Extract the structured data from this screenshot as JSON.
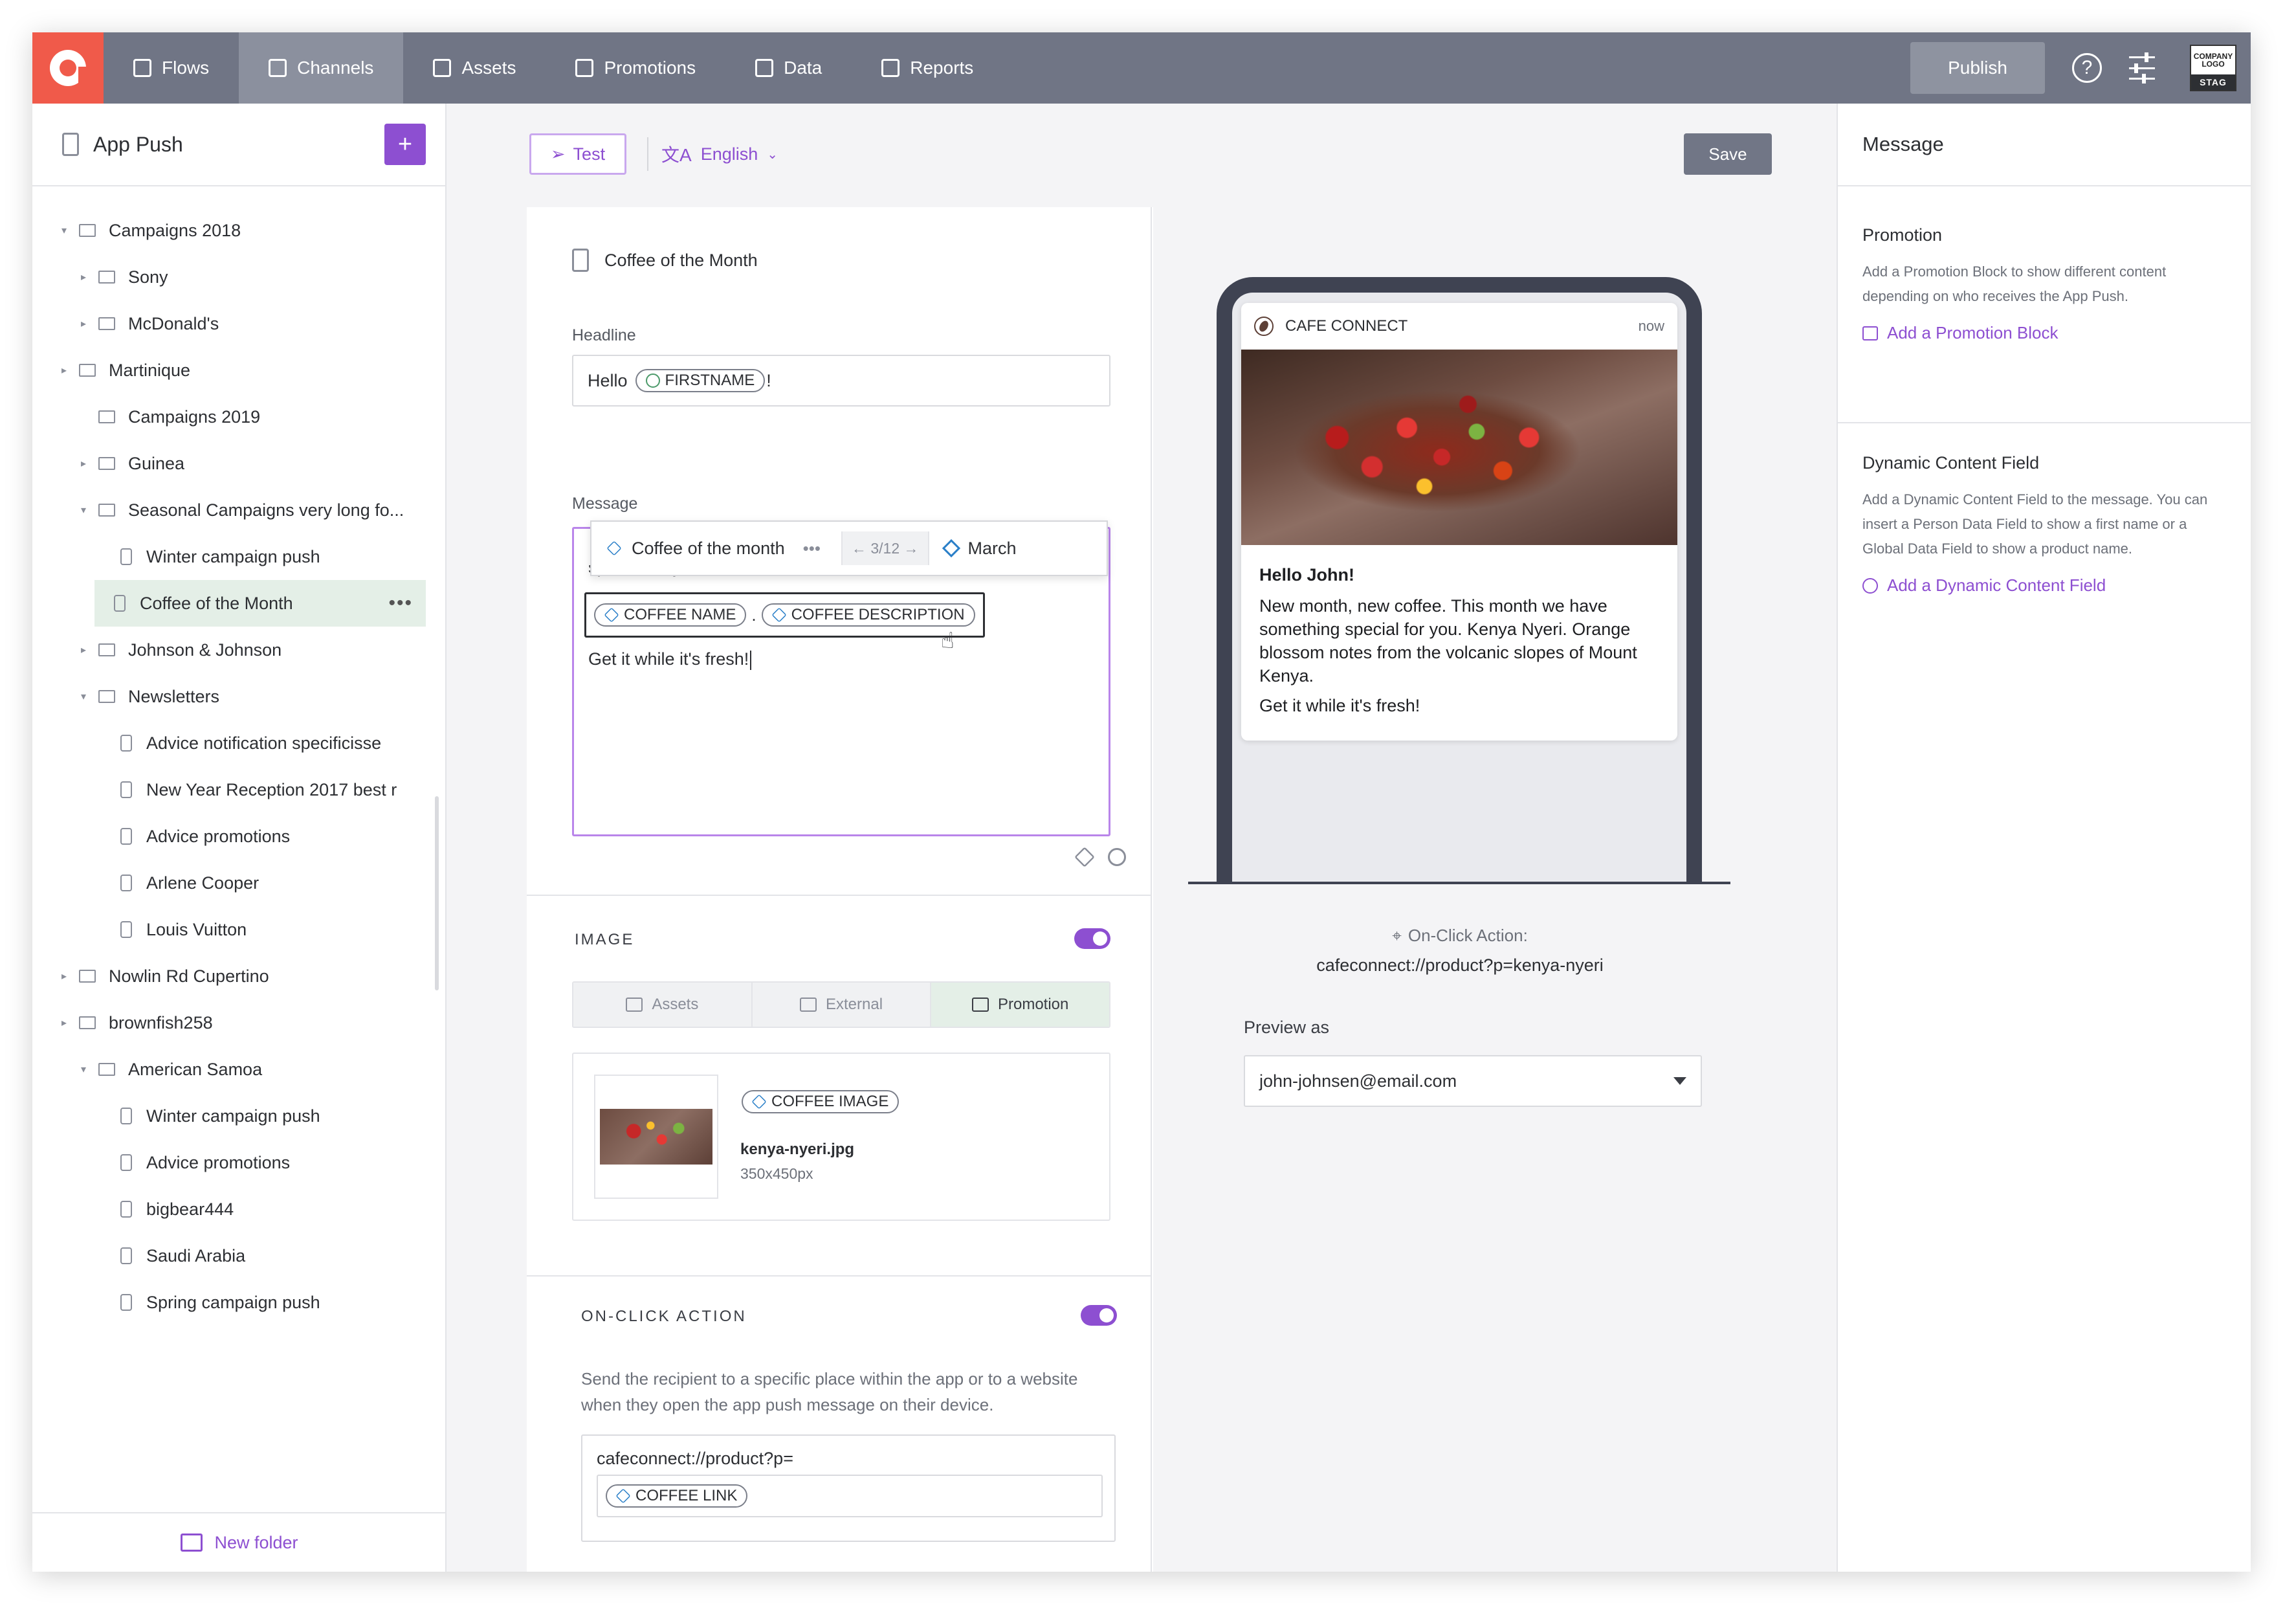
{
  "nav": {
    "items": [
      {
        "label": "Flows",
        "icon": "flow-icon"
      },
      {
        "label": "Channels",
        "icon": "channels-icon",
        "active": true
      },
      {
        "label": "Assets",
        "icon": "assets-icon"
      },
      {
        "label": "Promotions",
        "icon": "promotions-icon"
      },
      {
        "label": "Data",
        "icon": "database-icon"
      },
      {
        "label": "Reports",
        "icon": "reports-icon"
      }
    ],
    "publish_label": "Publish",
    "help_glyph": "?",
    "company_logo_text": "COMPANY LOGO",
    "environment": "STAG"
  },
  "sidebar": {
    "title": "App Push",
    "add_label": "+",
    "tree": [
      {
        "label": "Campaigns 2018",
        "type": "folder",
        "depth": 0,
        "caret": "▾"
      },
      {
        "label": "Sony",
        "type": "folder",
        "depth": 1,
        "caret": "▸"
      },
      {
        "label": "McDonald's",
        "type": "folder",
        "depth": 1,
        "caret": "▸"
      },
      {
        "label": "Martinique",
        "type": "folder",
        "depth": 0,
        "caret": "▸"
      },
      {
        "label": "Campaigns 2019",
        "type": "folder",
        "depth": 1,
        "caret": ""
      },
      {
        "label": "Guinea",
        "type": "folder",
        "depth": 1,
        "caret": "▸"
      },
      {
        "label": "Seasonal Campaigns very long fo...",
        "type": "folder",
        "depth": 1,
        "caret": "▾"
      },
      {
        "label": "Winter campaign push",
        "type": "message",
        "depth": 2
      },
      {
        "label": "Coffee of the Month",
        "type": "message",
        "depth": 2,
        "selected": true
      },
      {
        "label": "Johnson & Johnson",
        "type": "folder",
        "depth": 1,
        "caret": "▸"
      },
      {
        "label": "Newsletters",
        "type": "folder",
        "depth": 1,
        "caret": "▾"
      },
      {
        "label": "Advice notification specificisse",
        "type": "message",
        "depth": 2
      },
      {
        "label": "New Year Reception 2017 best r",
        "type": "message",
        "depth": 2
      },
      {
        "label": "Advice promotions",
        "type": "message",
        "depth": 2
      },
      {
        "label": "Arlene Cooper",
        "type": "message",
        "depth": 2
      },
      {
        "label": "Louis Vuitton",
        "type": "message",
        "depth": 2
      },
      {
        "label": "Nowlin Rd Cupertino",
        "type": "folder",
        "depth": 0,
        "caret": "▸"
      },
      {
        "label": "brownfish258",
        "type": "folder",
        "depth": 0,
        "caret": "▸"
      },
      {
        "label": "American Samoa",
        "type": "folder",
        "depth": 1,
        "caret": "▾"
      },
      {
        "label": "Winter campaign push",
        "type": "message",
        "depth": 2
      },
      {
        "label": "Advice promotions",
        "type": "message",
        "depth": 2
      },
      {
        "label": "bigbear444",
        "type": "message",
        "depth": 2
      },
      {
        "label": "Saudi Arabia",
        "type": "message",
        "depth": 2
      },
      {
        "label": "Spring campaign push",
        "type": "message",
        "depth": 2
      }
    ],
    "more_glyph": "•••",
    "new_folder_label": "New folder"
  },
  "toolbar": {
    "test_label": "Test",
    "language_label": "English",
    "language_glyph": "文A",
    "save_label": "Save"
  },
  "editor": {
    "message_name": "Coffee of the Month",
    "headline_label": "Headline",
    "headline_prefix": "Hello",
    "headline_token": "FIRSTNAME",
    "headline_suffix": "!",
    "message_label": "Message",
    "message_clipped": "special for you.",
    "token_coffee_name": "COFFEE NAME",
    "token_separator": ".",
    "token_coffee_description": "COFFEE DESCRIPTION",
    "message_last_line": "Get it while it's fresh!",
    "promo_popover": {
      "name": "Coffee of the month",
      "dots": "•••",
      "nav": "← 3/12 →",
      "variant": "March"
    },
    "image_section": {
      "title": "IMAGE",
      "enabled": true,
      "tabs": [
        {
          "label": "Assets",
          "active": false
        },
        {
          "label": "External",
          "active": false
        },
        {
          "label": "Promotion",
          "active": true
        }
      ],
      "token": "COFFEE IMAGE",
      "file_name": "kenya-nyeri.jpg",
      "file_size": "350x450px"
    },
    "onclick_section": {
      "title": "ON-CLICK ACTION",
      "enabled": true,
      "description": "Send the recipient to a specific place within the app or to a website when they open the app push message on their device.",
      "url_prefix": "cafeconnect://product?p=",
      "url_token": "COFFEE LINK"
    }
  },
  "preview": {
    "app_name": "CAFE CONNECT",
    "time": "now",
    "title": "Hello John!",
    "body": "New month, new coffee. This month we have something special for you. Kenya Nyeri. Orange blossom notes from the volcanic slopes of Mount Kenya.",
    "cta_line": "Get it while it's fresh!",
    "onclick_label": "On-Click Action:",
    "onclick_url": "cafeconnect://product?p=kenya-nyeri",
    "preview_as_label": "Preview as",
    "preview_as_value": "john-johnsen@email.com"
  },
  "rpanel": {
    "title": "Message",
    "promotion": {
      "title": "Promotion",
      "description": "Add a Promotion Block to show different content depending on who receives the App Push.",
      "link": "Add a Promotion Block"
    },
    "dynamic": {
      "title": "Dynamic Content Field",
      "description": "Add a Dynamic Content Field to the message. You can insert a Person Data Field to show a first name or a Global Data Field to show a product name.",
      "link": "Add a Dynamic Content Field"
    }
  },
  "colors": {
    "accent": "#8d4fd1",
    "nav_bg": "#707585",
    "logo_bg": "#f05a4a",
    "selected_bg": "#e4efe7"
  }
}
